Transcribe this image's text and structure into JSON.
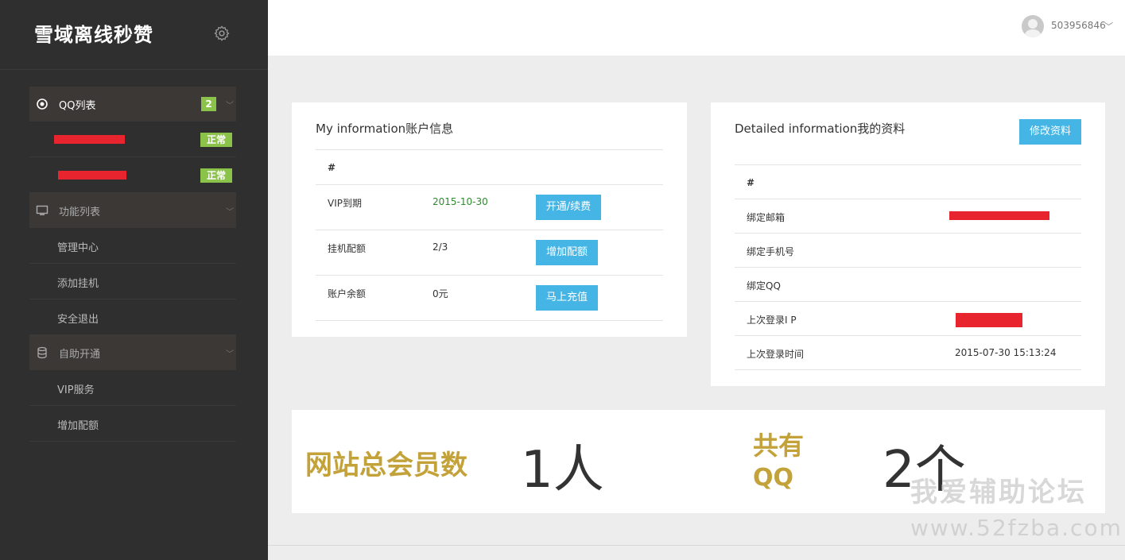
{
  "brand": {
    "title": "雪域离线秒赞",
    "settings_icon": "gear-icon"
  },
  "sidebar": {
    "groups": [
      {
        "label": "QQ列表",
        "icon": "qq-icon",
        "badge": "2",
        "items": [
          {
            "label": "",
            "status": "正常"
          },
          {
            "label": "",
            "status": "正常"
          }
        ]
      },
      {
        "label": "功能列表",
        "icon": "monitor-icon",
        "items": [
          {
            "label": "管理中心"
          },
          {
            "label": "添加挂机"
          },
          {
            "label": "安全退出"
          }
        ]
      },
      {
        "label": "自助开通",
        "icon": "database-icon",
        "items": [
          {
            "label": "VIP服务"
          },
          {
            "label": "增加配额"
          }
        ]
      }
    ]
  },
  "header": {
    "username": "503956846",
    "caret": "﹀"
  },
  "account": {
    "title": "My information账户信息",
    "header_col": "#",
    "rows": [
      {
        "label": "VIP到期",
        "value": "2015-10-30",
        "button": "开通/续费"
      },
      {
        "label": "挂机配额",
        "value": "2/3",
        "button": "增加配额"
      },
      {
        "label": "账户余额",
        "value": "0元",
        "button": "马上充值"
      }
    ]
  },
  "profile": {
    "title": "Detailed information我的资料",
    "edit_button": "修改资料",
    "header_col": "#",
    "rows": [
      {
        "label": "绑定邮箱",
        "value": ""
      },
      {
        "label": "绑定手机号",
        "value": ""
      },
      {
        "label": "绑定QQ",
        "value": ""
      },
      {
        "label": "上次登录I P",
        "value": ""
      },
      {
        "label": "上次登录时间",
        "value": "2015-07-30 15:13:24"
      }
    ]
  },
  "stats": {
    "members_label": "网站总会员数",
    "members_count": "1",
    "members_unit": "人",
    "qq_label_1": "共有",
    "qq_label_2": "QQ",
    "qq_count": "2",
    "qq_unit": "个"
  },
  "watermark": {
    "line1": "我爱辅助论坛",
    "line2": "www.52fzba.com"
  },
  "colors": {
    "sidebar": "#2f2f30",
    "badge": "#8bc34a",
    "button": "#44b5e5",
    "gold": "#c4a23a",
    "redaction": "#e8252e"
  }
}
